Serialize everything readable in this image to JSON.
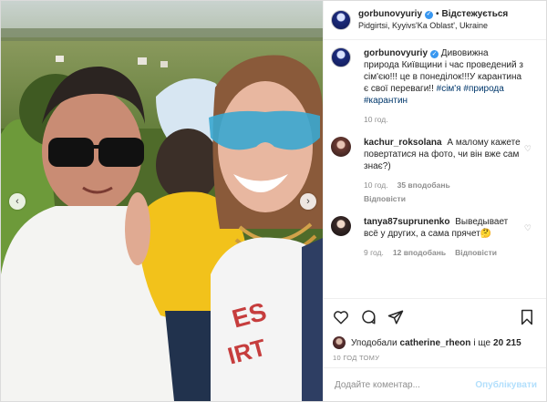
{
  "header": {
    "username": "gorbunovyuriy",
    "separator": "•",
    "follow_status": "Відстежується",
    "location": "Pidgirtsi, Kyyivs'Ka Oblast', Ukraine"
  },
  "caption": {
    "username": "gorbunovyuriy",
    "text": "Дивовижна природа Київщини і час проведений з сім'єю!!! це в понеділок!!!У карантина є свої переваги!! ",
    "tags": [
      "#сім'я",
      "#природа",
      "#карантин"
    ],
    "time": "10 год."
  },
  "comments": [
    {
      "username": "kachur_roksolana",
      "text": "А малому кажете повертатися на фото, чи він вже сам знає?)",
      "time": "10 год.",
      "likes": "35 вподобань",
      "reply": "Відповісти"
    },
    {
      "username": "tanya87suprunenko",
      "text": "Выведывает всё у других, а сама прячет🤔",
      "time": "9 год.",
      "likes": "12 вподобань",
      "reply": "Відповісти"
    }
  ],
  "likes_line": {
    "prefix": "Уподобали",
    "user": "catherine_rheon",
    "and": "і ще",
    "count": "20 215"
  },
  "posted_ago": "10 ГОД ТОМУ",
  "add_comment": {
    "placeholder": "Додайте коментар...",
    "publish_label": "Опублікувати"
  },
  "colors": {
    "verified": "#3897f0",
    "publish_disabled": "#b2dffc",
    "hashtag": "#00376b",
    "secondary_text": "#8e8e8e"
  },
  "icons": [
    "heart-icon",
    "comment-icon",
    "share-icon",
    "bookmark-icon",
    "chevron-left-icon",
    "chevron-right-icon",
    "verified-icon"
  ]
}
